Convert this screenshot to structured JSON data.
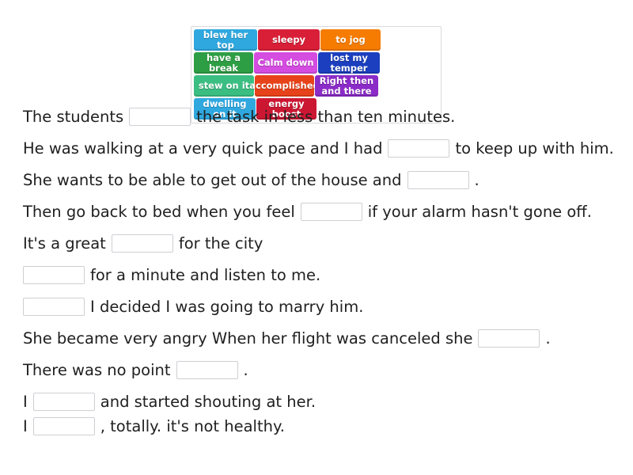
{
  "word_bank": {
    "name": "word-bank",
    "tiles": [
      {
        "label": "blew her top",
        "color": "#2FA8E0",
        "width": 80,
        "lines": 1
      },
      {
        "label": "sleepy",
        "color": "#D81F37",
        "width": 78,
        "lines": 1
      },
      {
        "label": "to jog",
        "color": "#F57C00",
        "width": 76,
        "lines": 1
      },
      {
        "label": "have a break",
        "color": "#2E9E44",
        "width": 75,
        "lines": 1
      },
      {
        "label": "Calm down",
        "color": "#D44CE0",
        "width": 80,
        "lines": 1
      },
      {
        "label": "lost my\ntemper",
        "color": "#1B3FBF",
        "width": 78,
        "lines": 2
      },
      {
        "label": "stew on it",
        "color": "#3BBE82",
        "width": 76,
        "lines": 1
      },
      {
        "label": "accomplished",
        "color": "#E8421A",
        "width": 75,
        "lines": 1
      },
      {
        "label": "Right then\nand there",
        "color": "#8B2BC8",
        "width": 80,
        "lines": 2
      },
      {
        "label": "dwelling on it",
        "color": "#2FA8E0",
        "width": 78,
        "lines": 1
      },
      {
        "label": "energy boost",
        "color": "#CC1733",
        "width": 76,
        "lines": 1
      }
    ]
  },
  "sentences": [
    {
      "id": "sentence-1",
      "parts": [
        {
          "type": "text",
          "value": "The students"
        },
        {
          "type": "blank",
          "value": ""
        },
        {
          "type": "text",
          "value": "the task in less than ten minutes."
        }
      ]
    },
    {
      "id": "sentence-2",
      "parts": [
        {
          "type": "text",
          "value": "He was walking at a very quick pace and I had"
        },
        {
          "type": "blank",
          "value": ""
        },
        {
          "type": "text",
          "value": "to keep up with him."
        }
      ]
    },
    {
      "id": "sentence-3",
      "parts": [
        {
          "type": "text",
          "value": "She wants to be able to get out of the house and"
        },
        {
          "type": "blank",
          "value": ""
        },
        {
          "type": "text",
          "value": "."
        }
      ]
    },
    {
      "id": "sentence-4",
      "parts": [
        {
          "type": "text",
          "value": "Then go back to bed when you feel"
        },
        {
          "type": "blank",
          "value": ""
        },
        {
          "type": "text",
          "value": "if your alarm hasn't gone off."
        }
      ]
    },
    {
      "id": "sentence-5",
      "parts": [
        {
          "type": "text",
          "value": "It's a great"
        },
        {
          "type": "blank",
          "value": ""
        },
        {
          "type": "text",
          "value": "for the city"
        }
      ]
    },
    {
      "id": "sentence-6",
      "parts": [
        {
          "type": "blank",
          "value": ""
        },
        {
          "type": "text",
          "value": "for a minute and listen to me."
        }
      ]
    },
    {
      "id": "sentence-7",
      "parts": [
        {
          "type": "blank",
          "value": ""
        },
        {
          "type": "text",
          "value": "I decided I was going to marry him."
        }
      ]
    },
    {
      "id": "sentence-8",
      "parts": [
        {
          "type": "text",
          "value": "She became very angry When her flight was canceled she"
        },
        {
          "type": "blank",
          "value": ""
        },
        {
          "type": "text",
          "value": "."
        }
      ]
    },
    {
      "id": "sentence-9",
      "parts": [
        {
          "type": "text",
          "value": "There was no point"
        },
        {
          "type": "blank",
          "value": ""
        },
        {
          "type": "text",
          "value": "."
        }
      ]
    },
    {
      "id": "sentence-10",
      "parts": [
        {
          "type": "text",
          "value": "I"
        },
        {
          "type": "blank",
          "value": ""
        },
        {
          "type": "text",
          "value": "and started shouting at her."
        }
      ]
    },
    {
      "id": "sentence-11",
      "parts": [
        {
          "type": "text",
          "value": "I"
        },
        {
          "type": "blank",
          "value": ""
        },
        {
          "type": "text",
          "value": ", totally. it's not healthy."
        }
      ]
    }
  ]
}
